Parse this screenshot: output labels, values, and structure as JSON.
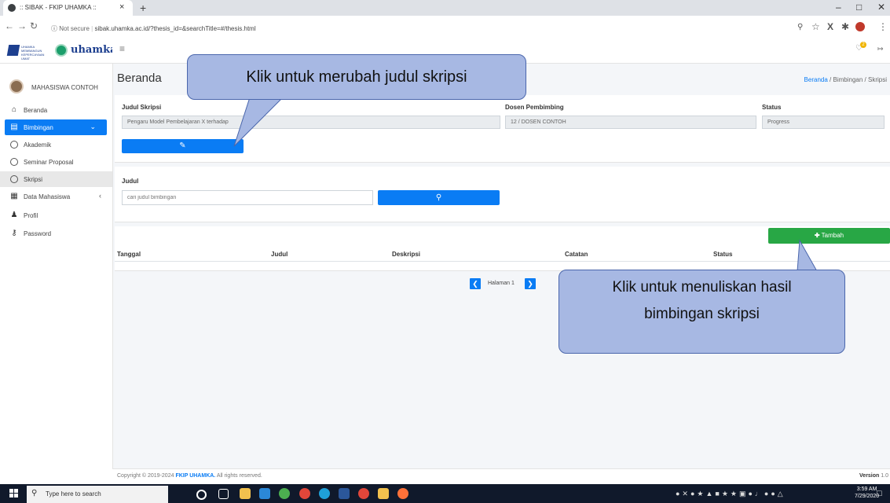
{
  "browser": {
    "tab_title": ":: SIBAK - FKIP UHAMKA ::",
    "new_tab": "+",
    "close_tab": "×",
    "address_security": "Not secure",
    "address_url": "sibak.uhamka.ac.id/?thesis_id=&searchTitle=#/thesis.html"
  },
  "brand": {
    "small_text": "UHAMKA MEMBANGUN KEPERCAYAAN UMAT",
    "logo_text": "uhamka"
  },
  "header": {
    "notification_count": "2"
  },
  "sidebar": {
    "user_name": "MAHASISWA CONTOH",
    "items": [
      {
        "label": "Beranda",
        "icon": "home-icon"
      },
      {
        "label": "Bimbingan",
        "icon": "list-icon"
      },
      {
        "label": "Akademik",
        "icon": "circle-icon"
      },
      {
        "label": "Seminar Proposal",
        "icon": "circle-icon"
      },
      {
        "label": "Skripsi",
        "icon": "circle-icon"
      },
      {
        "label": "Data Mahasiswa",
        "icon": "id-card-icon"
      },
      {
        "label": "Profil",
        "icon": "user-icon"
      },
      {
        "label": "Password",
        "icon": "key-icon"
      }
    ]
  },
  "page": {
    "title": "Beranda",
    "breadcrumb": [
      "Beranda",
      "Bimbingan",
      "Skripsi"
    ]
  },
  "thesis": {
    "judul_label": "Judul Skripsi",
    "judul_value": "Pengaru Model Pembelajaran X terhadap",
    "dosen_label": "Dosen Pembimbing",
    "dosen_value": "12 / DOSEN CONTOH",
    "status_label": "Status",
    "status_value": "Progress"
  },
  "search": {
    "label": "Judul",
    "placeholder": "cari judul bimbingan"
  },
  "table": {
    "add_button": "Tambah",
    "columns": [
      "Tanggal",
      "Judul",
      "Deskripsi",
      "Catatan",
      "Status"
    ]
  },
  "pagination": {
    "label": "Halaman 1"
  },
  "footer": {
    "copyright_prefix": "Copyright © 2019-2024 ",
    "copyright_brand": "FKIP UHAMKA.",
    "copyright_suffix": " All rights reserved.",
    "version_label": "Version",
    "version_value": "1.0"
  },
  "callouts": {
    "edit_title": "Klik untuk merubah judul skripsi",
    "add_line1": "Klik untuk menuliskan hasil",
    "add_line2": "bimbingan skripsi"
  },
  "taskbar": {
    "search_placeholder": "Type here to search",
    "time": "3:59 AM",
    "date": "7/29/2020"
  }
}
